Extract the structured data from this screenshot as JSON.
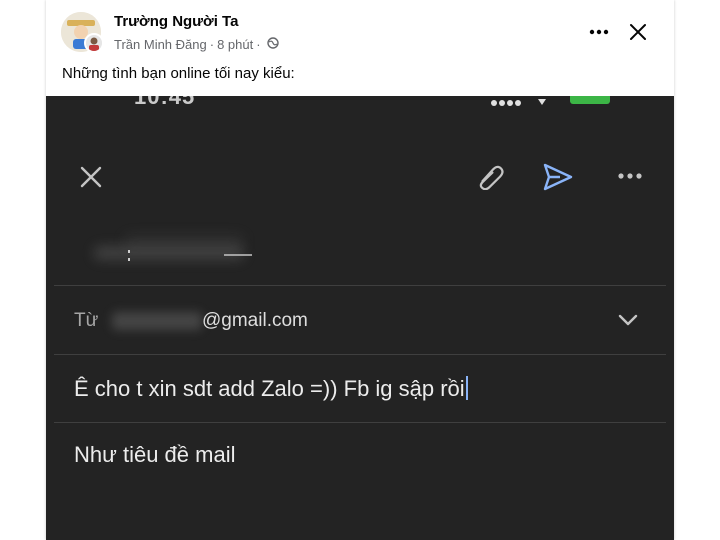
{
  "post": {
    "page_name": "Trường Người Ta",
    "author": "Trần Minh Đăng",
    "separator": "·",
    "time": "8 phút",
    "caption": "Những tình bạn online tối nay kiểu:",
    "privacy_icon": "globe-icon",
    "more_icon": "more-horizontal-icon",
    "close_icon": "close-icon"
  },
  "email_screenshot": {
    "status_time": "10:45",
    "from_label": "Từ",
    "from_email": "@gmail.com",
    "subject": "Ê cho t xin sdt add Zalo =)) Fb ig sập rồi",
    "body": "Như tiêu đề mail",
    "icons": [
      "close-icon",
      "paperclip-icon",
      "send-icon",
      "more-horizontal-icon",
      "chevron-down-icon"
    ],
    "colors": {
      "background": "#232323",
      "send_accent": "#8ab4f8",
      "text": "#ececec",
      "muted": "#a6a6a6"
    }
  }
}
